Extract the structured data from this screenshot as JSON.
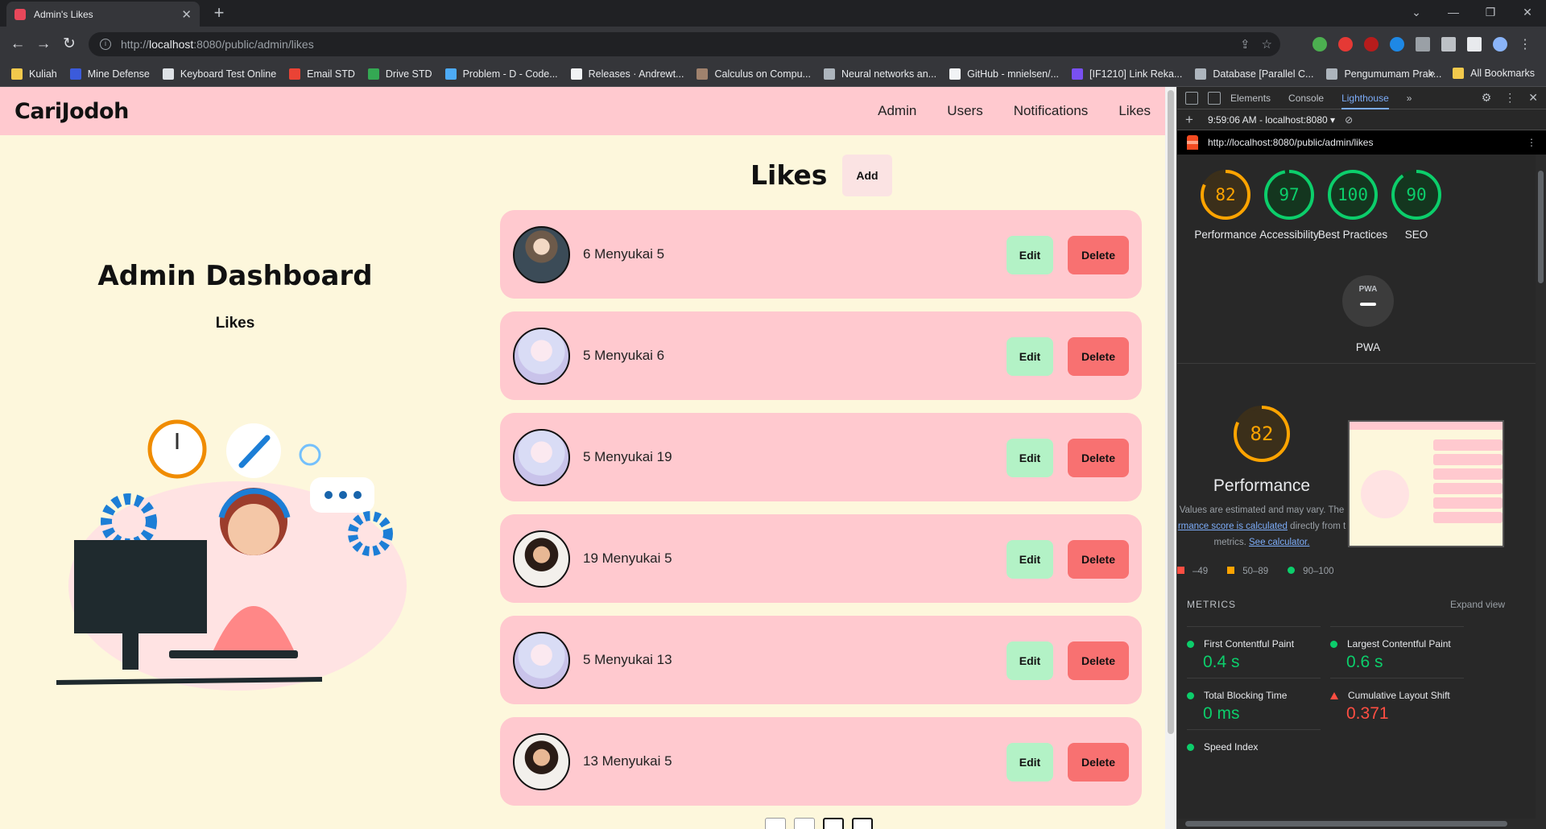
{
  "browser": {
    "tab_title": "Admin's Likes",
    "url_prefix": "http://",
    "url_host": "localhost",
    "url_rest": ":8080/public/admin/likes",
    "bookmarks": [
      {
        "label": "Kuliah",
        "color": "#f2c94c"
      },
      {
        "label": "Mine Defense",
        "color": "#3b5bdb"
      },
      {
        "label": "Keyboard Test Online",
        "color": "#dee2e6"
      },
      {
        "label": "Email STD",
        "color": "#ea4335"
      },
      {
        "label": "Drive STD",
        "color": "#34a853"
      },
      {
        "label": "Problem - D - Code...",
        "color": "#4dabf7"
      },
      {
        "label": "Releases · Andrewt...",
        "color": "#f1f3f5"
      },
      {
        "label": "Calculus on Compu...",
        "color": "#a0826d"
      },
      {
        "label": "Neural networks an...",
        "color": "#adb5bd"
      },
      {
        "label": "GitHub - mnielsen/...",
        "color": "#f1f3f5"
      },
      {
        "label": "[IF1210] Link Reka...",
        "color": "#7950f2"
      },
      {
        "label": "Database [Parallel C...",
        "color": "#adb5bd"
      },
      {
        "label": "Pengumumam Prak...",
        "color": "#adb5bd"
      }
    ],
    "more_bookmarks": "»",
    "all_bookmarks": "All Bookmarks"
  },
  "app": {
    "brand": "CariJodoh",
    "nav": [
      "Admin",
      "Users",
      "Notifications",
      "Likes"
    ],
    "dashboard_title": "Admin Dashboard",
    "dashboard_subtitle": "Likes",
    "list_title": "Likes",
    "add_label": "Add",
    "edit_label": "Edit",
    "delete_label": "Delete",
    "likes": [
      {
        "text": "6 Menyukai 5",
        "avatar": "anime"
      },
      {
        "text": "5 Menyukai 6",
        "avatar": "idol"
      },
      {
        "text": "5 Menyukai 19",
        "avatar": "idol"
      },
      {
        "text": "19 Menyukai 5",
        "avatar": "woman"
      },
      {
        "text": "5 Menyukai 13",
        "avatar": "idol"
      },
      {
        "text": "13 Menyukai 5",
        "avatar": "woman"
      }
    ]
  },
  "devtools": {
    "tabs": [
      "Elements",
      "Console",
      "Lighthouse"
    ],
    "active_tab": "Lighthouse",
    "report_time": "9:59:06 AM - localhost:8080 ▾",
    "report_url": "http://localhost:8080/public/admin/likes",
    "scores": [
      {
        "label": "Performance",
        "value": "82",
        "color": "#ffa400"
      },
      {
        "label": "Accessibility",
        "value": "97",
        "color": "#0cce6b"
      },
      {
        "label": "Best Practices",
        "value": "100",
        "color": "#0cce6b"
      },
      {
        "label": "SEO",
        "value": "90",
        "color": "#0cce6b"
      }
    ],
    "pwa_badge": "PWA",
    "pwa_label": "PWA",
    "perf_score": "82",
    "perf_title": "Performance",
    "perf_desc_1": "Values are estimated and may vary. The",
    "perf_desc_link1": "rmance score is calculated",
    "perf_desc_2": "directly from t",
    "perf_desc_3": "metrics.",
    "perf_desc_link2": "See calculator.",
    "legend": [
      {
        "label": "–49",
        "color": "#ff4e42"
      },
      {
        "label": "50–89",
        "color": "#ffa400"
      },
      {
        "label": "90–100",
        "color": "#0cce6b"
      }
    ],
    "metrics_header": "METRICS",
    "expand_label": "Expand view",
    "metrics": [
      {
        "name": "First Contentful Paint",
        "value": "0.4 s",
        "status": "good"
      },
      {
        "name": "Largest Contentful Paint",
        "value": "0.6 s",
        "status": "good"
      },
      {
        "name": "Total Blocking Time",
        "value": "0 ms",
        "status": "good"
      },
      {
        "name": "Cumulative Layout Shift",
        "value": "0.371",
        "status": "bad"
      },
      {
        "name": "Speed Index",
        "value": "",
        "status": "good"
      }
    ]
  }
}
